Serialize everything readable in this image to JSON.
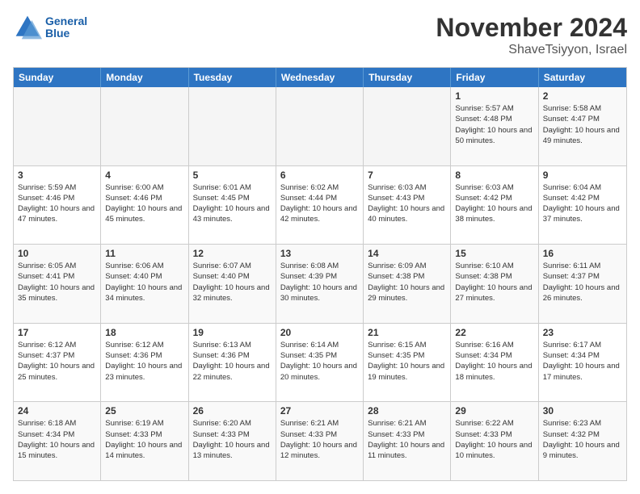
{
  "logo": {
    "line1": "General",
    "line2": "Blue"
  },
  "title": "November 2024",
  "location": "ShaveTsiyyon, Israel",
  "days_of_week": [
    "Sunday",
    "Monday",
    "Tuesday",
    "Wednesday",
    "Thursday",
    "Friday",
    "Saturday"
  ],
  "weeks": [
    [
      {
        "day": "",
        "info": "",
        "empty": true
      },
      {
        "day": "",
        "info": "",
        "empty": true
      },
      {
        "day": "",
        "info": "",
        "empty": true
      },
      {
        "day": "",
        "info": "",
        "empty": true
      },
      {
        "day": "",
        "info": "",
        "empty": true
      },
      {
        "day": "1",
        "info": "Sunrise: 5:57 AM\nSunset: 4:48 PM\nDaylight: 10 hours\nand 50 minutes.",
        "empty": false
      },
      {
        "day": "2",
        "info": "Sunrise: 5:58 AM\nSunset: 4:47 PM\nDaylight: 10 hours\nand 49 minutes.",
        "empty": false
      }
    ],
    [
      {
        "day": "3",
        "info": "Sunrise: 5:59 AM\nSunset: 4:46 PM\nDaylight: 10 hours\nand 47 minutes.",
        "empty": false
      },
      {
        "day": "4",
        "info": "Sunrise: 6:00 AM\nSunset: 4:46 PM\nDaylight: 10 hours\nand 45 minutes.",
        "empty": false
      },
      {
        "day": "5",
        "info": "Sunrise: 6:01 AM\nSunset: 4:45 PM\nDaylight: 10 hours\nand 43 minutes.",
        "empty": false
      },
      {
        "day": "6",
        "info": "Sunrise: 6:02 AM\nSunset: 4:44 PM\nDaylight: 10 hours\nand 42 minutes.",
        "empty": false
      },
      {
        "day": "7",
        "info": "Sunrise: 6:03 AM\nSunset: 4:43 PM\nDaylight: 10 hours\nand 40 minutes.",
        "empty": false
      },
      {
        "day": "8",
        "info": "Sunrise: 6:03 AM\nSunset: 4:42 PM\nDaylight: 10 hours\nand 38 minutes.",
        "empty": false
      },
      {
        "day": "9",
        "info": "Sunrise: 6:04 AM\nSunset: 4:42 PM\nDaylight: 10 hours\nand 37 minutes.",
        "empty": false
      }
    ],
    [
      {
        "day": "10",
        "info": "Sunrise: 6:05 AM\nSunset: 4:41 PM\nDaylight: 10 hours\nand 35 minutes.",
        "empty": false
      },
      {
        "day": "11",
        "info": "Sunrise: 6:06 AM\nSunset: 4:40 PM\nDaylight: 10 hours\nand 34 minutes.",
        "empty": false
      },
      {
        "day": "12",
        "info": "Sunrise: 6:07 AM\nSunset: 4:40 PM\nDaylight: 10 hours\nand 32 minutes.",
        "empty": false
      },
      {
        "day": "13",
        "info": "Sunrise: 6:08 AM\nSunset: 4:39 PM\nDaylight: 10 hours\nand 30 minutes.",
        "empty": false
      },
      {
        "day": "14",
        "info": "Sunrise: 6:09 AM\nSunset: 4:38 PM\nDaylight: 10 hours\nand 29 minutes.",
        "empty": false
      },
      {
        "day": "15",
        "info": "Sunrise: 6:10 AM\nSunset: 4:38 PM\nDaylight: 10 hours\nand 27 minutes.",
        "empty": false
      },
      {
        "day": "16",
        "info": "Sunrise: 6:11 AM\nSunset: 4:37 PM\nDaylight: 10 hours\nand 26 minutes.",
        "empty": false
      }
    ],
    [
      {
        "day": "17",
        "info": "Sunrise: 6:12 AM\nSunset: 4:37 PM\nDaylight: 10 hours\nand 25 minutes.",
        "empty": false
      },
      {
        "day": "18",
        "info": "Sunrise: 6:12 AM\nSunset: 4:36 PM\nDaylight: 10 hours\nand 23 minutes.",
        "empty": false
      },
      {
        "day": "19",
        "info": "Sunrise: 6:13 AM\nSunset: 4:36 PM\nDaylight: 10 hours\nand 22 minutes.",
        "empty": false
      },
      {
        "day": "20",
        "info": "Sunrise: 6:14 AM\nSunset: 4:35 PM\nDaylight: 10 hours\nand 20 minutes.",
        "empty": false
      },
      {
        "day": "21",
        "info": "Sunrise: 6:15 AM\nSunset: 4:35 PM\nDaylight: 10 hours\nand 19 minutes.",
        "empty": false
      },
      {
        "day": "22",
        "info": "Sunrise: 6:16 AM\nSunset: 4:34 PM\nDaylight: 10 hours\nand 18 minutes.",
        "empty": false
      },
      {
        "day": "23",
        "info": "Sunrise: 6:17 AM\nSunset: 4:34 PM\nDaylight: 10 hours\nand 17 minutes.",
        "empty": false
      }
    ],
    [
      {
        "day": "24",
        "info": "Sunrise: 6:18 AM\nSunset: 4:34 PM\nDaylight: 10 hours\nand 15 minutes.",
        "empty": false
      },
      {
        "day": "25",
        "info": "Sunrise: 6:19 AM\nSunset: 4:33 PM\nDaylight: 10 hours\nand 14 minutes.",
        "empty": false
      },
      {
        "day": "26",
        "info": "Sunrise: 6:20 AM\nSunset: 4:33 PM\nDaylight: 10 hours\nand 13 minutes.",
        "empty": false
      },
      {
        "day": "27",
        "info": "Sunrise: 6:21 AM\nSunset: 4:33 PM\nDaylight: 10 hours\nand 12 minutes.",
        "empty": false
      },
      {
        "day": "28",
        "info": "Sunrise: 6:21 AM\nSunset: 4:33 PM\nDaylight: 10 hours\nand 11 minutes.",
        "empty": false
      },
      {
        "day": "29",
        "info": "Sunrise: 6:22 AM\nSunset: 4:33 PM\nDaylight: 10 hours\nand 10 minutes.",
        "empty": false
      },
      {
        "day": "30",
        "info": "Sunrise: 6:23 AM\nSunset: 4:32 PM\nDaylight: 10 hours\nand 9 minutes.",
        "empty": false
      }
    ]
  ]
}
